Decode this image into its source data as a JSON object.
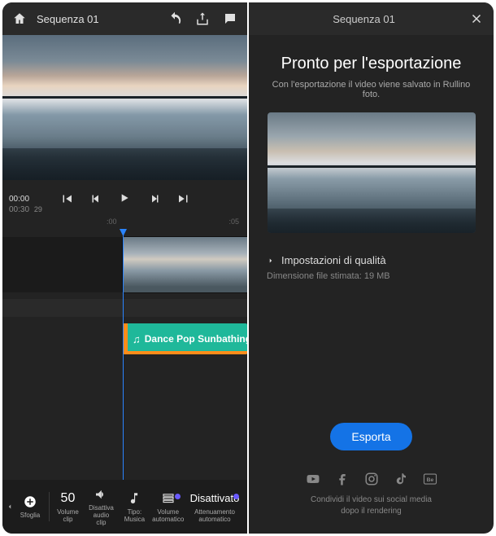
{
  "left": {
    "header": {
      "title": "Sequenza 01"
    },
    "time": {
      "current": "00:00",
      "duration": "00:30",
      "fps": "29"
    },
    "ruler": {
      "mark_neg": ":00",
      "mark_pos": ":05"
    },
    "audio_clip": {
      "label": "Dance Pop Sunbathing F"
    },
    "toolbar": {
      "browse": "Sfoglia",
      "volume_clip_value": "50",
      "volume_clip_label": "Volume clip",
      "mute_label": "Disattiva audio clip",
      "type_value": "Tipo:",
      "type_label": "Musica",
      "auto_volume": "Volume automatico",
      "ducking_value": "Disattivato",
      "ducking_label": "Attenuamento automatico"
    }
  },
  "right": {
    "header": {
      "title": "Sequenza 01"
    },
    "export": {
      "title": "Pronto per l'esportazione",
      "subtitle": "Con l'esportazione il video viene salvato in Rullino foto.",
      "quality_label": "Impostazioni di qualità",
      "filesize": "Dimensione file stimata: 19 MB",
      "button": "Esporta",
      "footer_line1": "Condividi il video sui social media",
      "footer_line2": "dopo il rendering"
    }
  }
}
